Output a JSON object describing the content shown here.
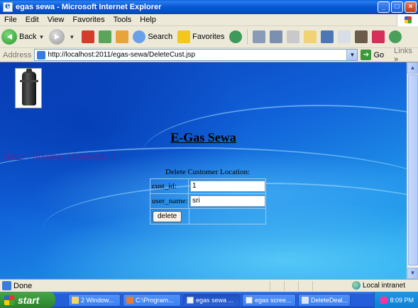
{
  "window": {
    "title": "egas sewa - Microsoft Internet Explorer",
    "controls": [
      "_",
      "□",
      "×"
    ]
  },
  "menu": [
    "File",
    "Edit",
    "View",
    "Favorites",
    "Tools",
    "Help"
  ],
  "toolbar": {
    "back_label": "Back",
    "search_label": "Search",
    "favorites_label": "Favorites"
  },
  "address": {
    "label": "Address",
    "url": "http://localhost:2011/egas-sewa/DeleteCust.jsp",
    "go_label": "Go",
    "links_label": "Links",
    "links_chevron": "»"
  },
  "page": {
    "site_title": "E-Gas Sewa",
    "nav": [
      "Home",
      "AboutUs",
      "ContactUs"
    ],
    "form_caption": "Delete Customer Location:",
    "fields": [
      {
        "label": "cust_id:",
        "value": "1"
      },
      {
        "label": "user_name:",
        "value": "sri"
      }
    ],
    "delete_label": "delete"
  },
  "status": {
    "text": "Done",
    "zone": "Local intranet"
  },
  "taskbar": {
    "start_label": "start",
    "tasks": [
      {
        "label": "2 Window...",
        "active": false
      },
      {
        "label": "C:\\Program...",
        "active": false
      },
      {
        "label": "egas sewa ...",
        "active": true
      },
      {
        "label": "egas scree...",
        "active": false
      },
      {
        "label": "DeleteDeal...",
        "active": false
      }
    ],
    "clock": "8:09 PM"
  }
}
